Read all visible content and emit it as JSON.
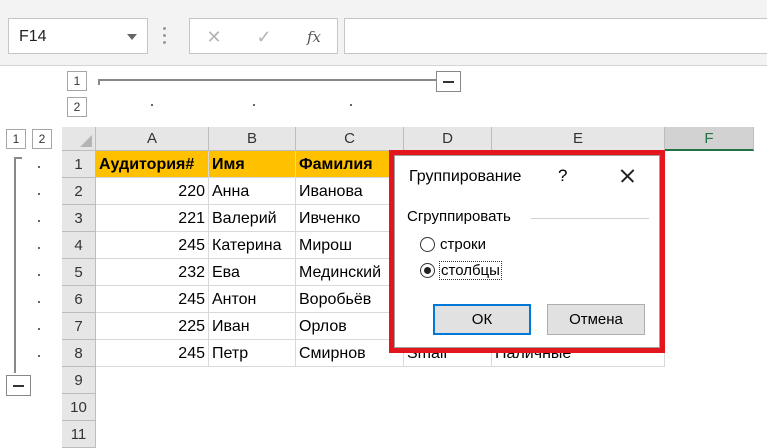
{
  "formula_bar": {
    "name_box": "F14",
    "cancel_icon": "✕",
    "enter_icon": "✓",
    "fx_label": "fx",
    "formula": ""
  },
  "outline": {
    "col_levels": [
      "1",
      "2"
    ],
    "row_levels": [
      "1",
      "2"
    ]
  },
  "grid": {
    "columns": [
      "A",
      "B",
      "C",
      "D",
      "E",
      "F"
    ],
    "active_column": "F",
    "rows": [
      "1",
      "2",
      "3",
      "4",
      "5",
      "6",
      "7",
      "8",
      "9",
      "10",
      "11"
    ],
    "cells": [
      [
        "Аудитория#",
        "Имя",
        "Фамилия",
        "",
        ""
      ],
      [
        "220",
        "Анна",
        "Иванова",
        "",
        ""
      ],
      [
        "221",
        "Валерий",
        "Ивченко",
        "",
        ""
      ],
      [
        "245",
        "Катерина",
        "Мирош",
        "",
        ""
      ],
      [
        "232",
        "Ева",
        "Мединский",
        "",
        ""
      ],
      [
        "245",
        "Антон",
        "Воробьёв",
        "",
        ""
      ],
      [
        "225",
        "Иван",
        "Орлов",
        "",
        ""
      ],
      [
        "245",
        "Петр",
        "Смирнов",
        "Small",
        "Наличные"
      ]
    ]
  },
  "dialog": {
    "title": "Группирование",
    "help": "?",
    "group_label": "Сгруппировать",
    "option_rows": "строки",
    "option_cols": "столбцы",
    "selected": "столбцы",
    "ok": "ОК",
    "cancel": "Отмена",
    "highlight_color": "#e3161e"
  }
}
